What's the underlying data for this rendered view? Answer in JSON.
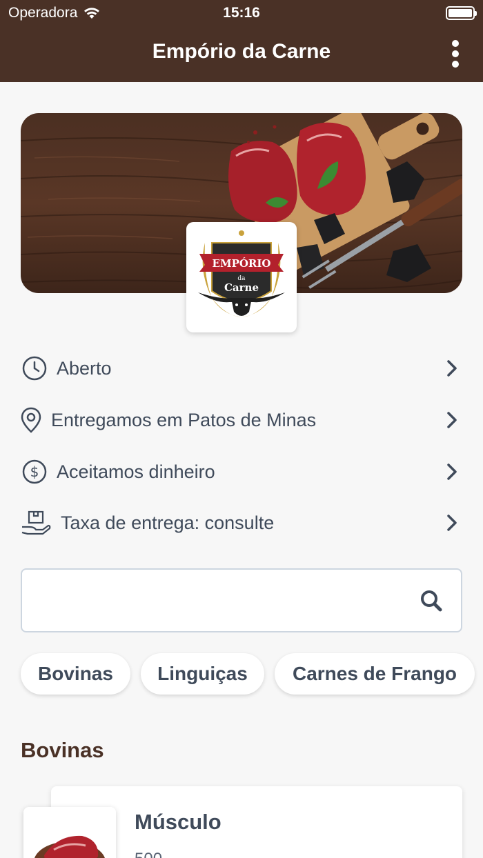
{
  "status_bar": {
    "carrier": "Operadora",
    "time": "15:16"
  },
  "header": {
    "title": "Empório da Carne"
  },
  "logo": {
    "top_text": "EMPÓRIO",
    "middle_text": "da",
    "bottom_text": "Carne"
  },
  "info_rows": [
    {
      "icon": "clock-icon",
      "label": "Aberto"
    },
    {
      "icon": "location-pin-icon",
      "label": "Entregamos em Patos de Minas"
    },
    {
      "icon": "dollar-icon",
      "label": "Aceitamos dinheiro"
    },
    {
      "icon": "delivery-box-icon",
      "label": "Taxa de entrega: consulte"
    }
  ],
  "search": {
    "placeholder": ""
  },
  "categories": [
    "Bovinas",
    "Linguiças",
    "Carnes de Frango"
  ],
  "section": {
    "title": "Bovinas"
  },
  "products": [
    {
      "name": "Músculo",
      "weight": "500"
    }
  ],
  "colors": {
    "header_bg": "#4a3126",
    "text": "#3f4a5a",
    "section_title": "#4a3126"
  }
}
